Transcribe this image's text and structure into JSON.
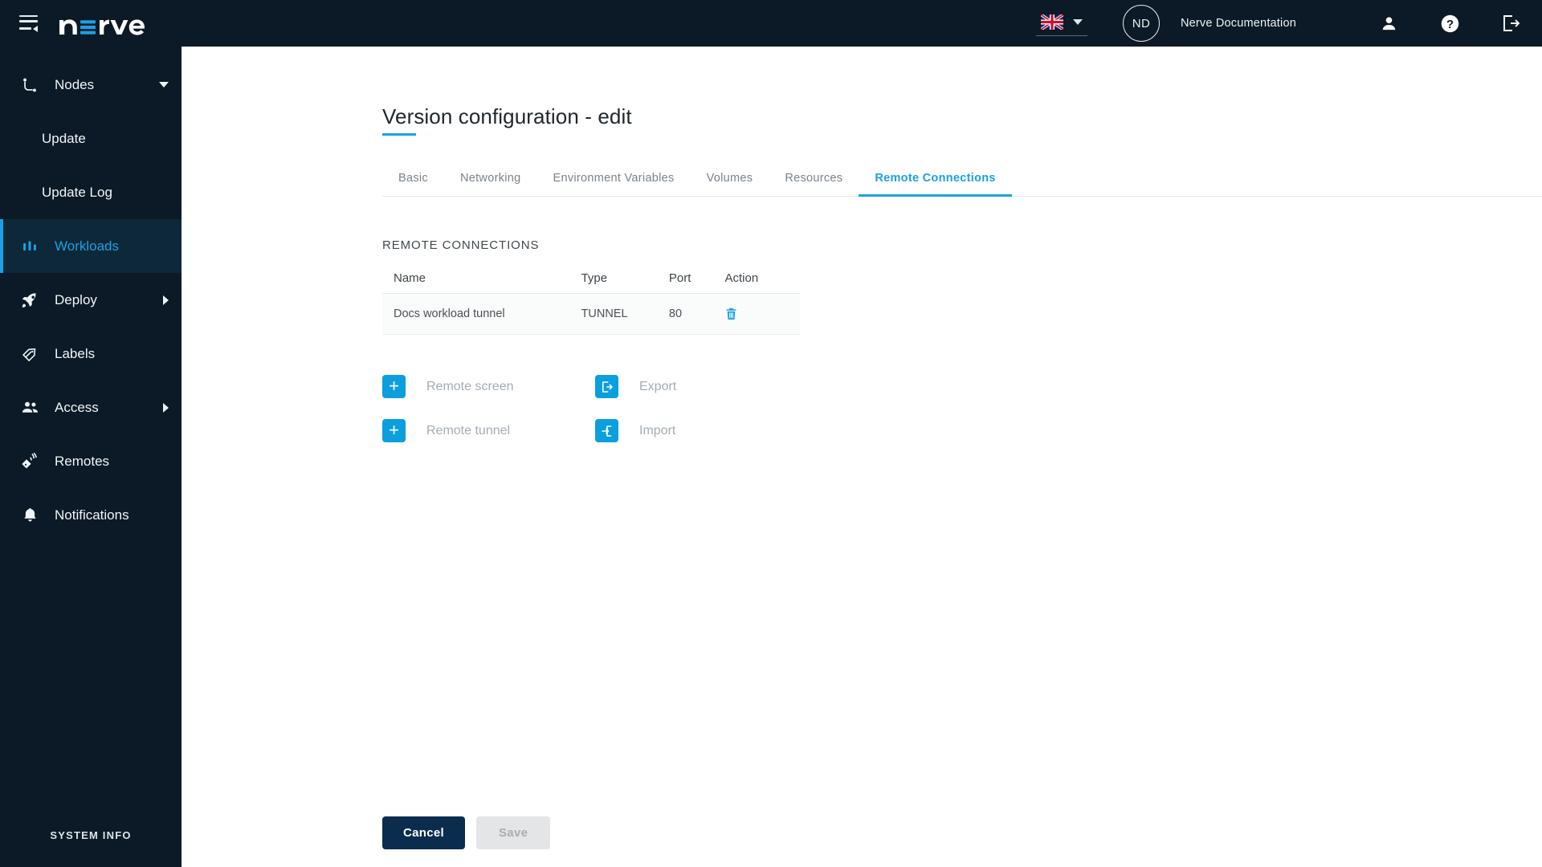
{
  "topbar": {
    "menu_icon": "hamburger-collapse-icon",
    "logo_text": "nerve",
    "language": "English (UK)",
    "lang_icon": "uk-flag-icon",
    "avatar_initials": "ND",
    "username": "Nerve Documentation",
    "icons": [
      {
        "name": "user-icon",
        "label": "User"
      },
      {
        "name": "help-icon",
        "label": "Help"
      },
      {
        "name": "logout-icon",
        "label": "Logout"
      }
    ]
  },
  "sidebar": {
    "items": [
      {
        "label": "Nodes",
        "icon": "nodes-icon",
        "chevron": "down",
        "active": false,
        "sub": false
      },
      {
        "label": "Update",
        "icon": "",
        "chevron": "",
        "active": false,
        "sub": true
      },
      {
        "label": "Update Log",
        "icon": "",
        "chevron": "",
        "active": false,
        "sub": true
      },
      {
        "label": "Workloads",
        "icon": "workloads-icon",
        "chevron": "",
        "active": true,
        "sub": false
      },
      {
        "label": "Deploy",
        "icon": "deploy-rocket-icon",
        "chevron": "right",
        "active": false,
        "sub": false
      },
      {
        "label": "Labels",
        "icon": "labels-tag-icon",
        "chevron": "",
        "active": false,
        "sub": false
      },
      {
        "label": "Access",
        "icon": "access-people-icon",
        "chevron": "right",
        "active": false,
        "sub": false
      },
      {
        "label": "Remotes",
        "icon": "remotes-icon",
        "chevron": "",
        "active": false,
        "sub": false
      },
      {
        "label": "Notifications",
        "icon": "bell-icon",
        "chevron": "",
        "active": false,
        "sub": false
      }
    ],
    "system_info": "SYSTEM INFO"
  },
  "page": {
    "title": "Version configuration - edit",
    "tabs": [
      {
        "label": "Basic",
        "active": false
      },
      {
        "label": "Networking",
        "active": false
      },
      {
        "label": "Environment Variables",
        "active": false
      },
      {
        "label": "Volumes",
        "active": false
      },
      {
        "label": "Resources",
        "active": false
      },
      {
        "label": "Remote Connections",
        "active": true
      }
    ],
    "section_label": "REMOTE CONNECTIONS",
    "table": {
      "headers": [
        "Name",
        "Type",
        "Port",
        "Action"
      ],
      "rows": [
        {
          "name": "Docs workload tunnel",
          "type": "TUNNEL",
          "port": "80",
          "action_icon": "trash-icon"
        }
      ]
    },
    "actions": [
      {
        "label": "Remote screen",
        "icon": "plus-icon"
      },
      {
        "label": "Remote tunnel",
        "icon": "plus-icon"
      },
      {
        "label": "Export",
        "icon": "export-icon"
      },
      {
        "label": "Import",
        "icon": "import-icon"
      }
    ],
    "footer": {
      "cancel": "Cancel",
      "save": "Save"
    }
  },
  "colors": {
    "dark_navy": "#0b1a26",
    "accent_blue": "#1ba1e2",
    "icon_blue": "#0b9fdd",
    "cancel_navy": "#0a2d4d",
    "disabled_gray": "#e3e5e6"
  }
}
